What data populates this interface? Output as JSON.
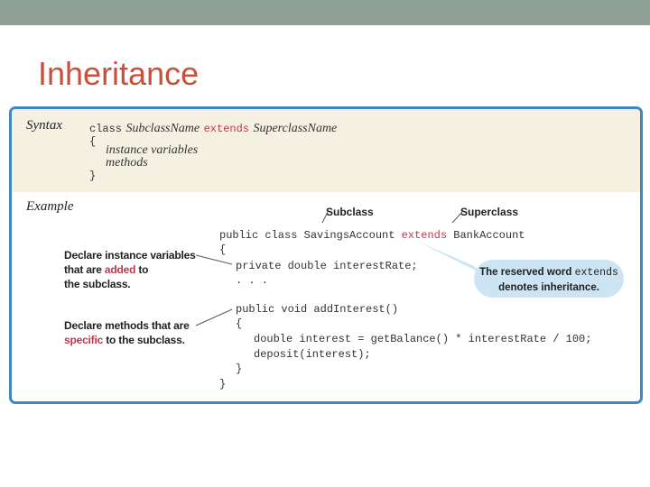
{
  "slide": {
    "title": "Inheritance"
  },
  "syntax": {
    "label": "Syntax",
    "line1": {
      "kw_class": "class",
      "subclass": "SubclassName",
      "kw_extends": "extends",
      "superclass": "SuperclassName"
    },
    "open_brace": "{",
    "instance_variables": "instance variables",
    "methods": "methods",
    "close_brace": "}"
  },
  "example": {
    "label": "Example",
    "callout_subclass": "Subclass",
    "callout_superclass": "Superclass",
    "code": {
      "line1_a": "public class SavingsAccount ",
      "line1_kw": "extends",
      "line1_b": " BankAccount",
      "line2": "{",
      "line3": "private double interestRate;",
      "line4": ". . .",
      "line5": "public void addInterest()",
      "line6": "{",
      "line7": "double interest = getBalance() * interestRate / 100;",
      "line8": "deposit(interest);",
      "line9": "}",
      "line10": "}"
    },
    "note_instance": {
      "part1": "Declare instance variables",
      "part2": "that are ",
      "highlight": "added",
      "part3": " to",
      "part4": "the subclass."
    },
    "note_methods": {
      "part1": "Declare methods that are",
      "highlight": "specific",
      "part2": " to the subclass."
    },
    "bubble": {
      "part1": "The reserved word ",
      "mono": "extends",
      "part2": "denotes inheritance."
    }
  },
  "colors": {
    "title": "#c9503a",
    "keyword": "#c0364f",
    "frame_border": "#3f86c6",
    "bubble": "#cde4f4",
    "top_bar": "#8fa197"
  }
}
